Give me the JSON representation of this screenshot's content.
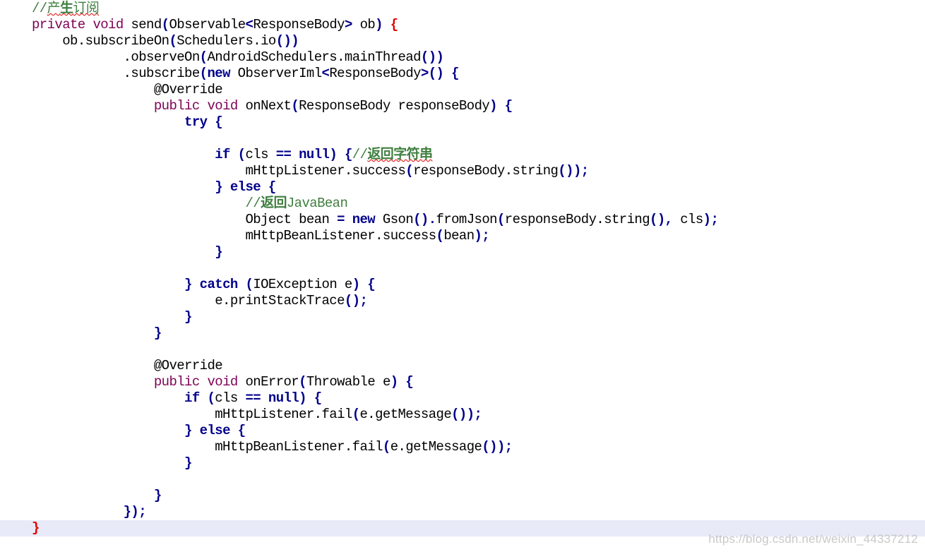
{
  "editor": {
    "current_line_index": 32,
    "lines": [
      {
        "indent": "",
        "tokens": [
          [
            "//",
            "cmt"
          ],
          [
            "产",
            "cmt-sq"
          ],
          [
            "生",
            "cmt-b-sq"
          ],
          [
            "订阅",
            "cmt-sq"
          ]
        ]
      },
      {
        "indent": "",
        "tokens": [
          [
            "private",
            "mod"
          ],
          [
            " ",
            "bk"
          ],
          [
            "void",
            "mod"
          ],
          [
            " send",
            "bk"
          ],
          [
            "(",
            "bl"
          ],
          [
            "Observable",
            "bk"
          ],
          [
            "<",
            "bl"
          ],
          [
            "ResponseBody",
            "bk"
          ],
          [
            ">",
            "bl"
          ],
          [
            " ob",
            "bk"
          ],
          [
            ")",
            "bl"
          ],
          [
            " ",
            "bk"
          ],
          [
            "{",
            "red"
          ]
        ]
      },
      {
        "indent": "    ",
        "tokens": [
          [
            "ob.subscribeOn",
            "bk"
          ],
          [
            "(",
            "bl"
          ],
          [
            "Schedulers.io",
            "bk"
          ],
          [
            "())",
            "bl"
          ]
        ]
      },
      {
        "indent": "            ",
        "tokens": [
          [
            ".observeOn",
            "bk"
          ],
          [
            "(",
            "bl"
          ],
          [
            "AndroidSchedulers.mainThread",
            "bk"
          ],
          [
            "())",
            "bl"
          ]
        ]
      },
      {
        "indent": "            ",
        "tokens": [
          [
            ".subscribe",
            "bk"
          ],
          [
            "(",
            "bl"
          ],
          [
            "new",
            "kwb"
          ],
          [
            " ObserverIml",
            "bk"
          ],
          [
            "<",
            "bl"
          ],
          [
            "ResponseBody",
            "bk"
          ],
          [
            ">()",
            "bl"
          ],
          [
            " ",
            "bk"
          ],
          [
            "{",
            "bl"
          ]
        ]
      },
      {
        "indent": "                ",
        "tokens": [
          [
            "@Override",
            "bk"
          ]
        ]
      },
      {
        "indent": "                ",
        "tokens": [
          [
            "public",
            "mod"
          ],
          [
            " ",
            "bk"
          ],
          [
            "void",
            "mod"
          ],
          [
            " onNext",
            "bk"
          ],
          [
            "(",
            "bl"
          ],
          [
            "ResponseBody responseBody",
            "bk"
          ],
          [
            ")",
            "bl"
          ],
          [
            " ",
            "bk"
          ],
          [
            "{",
            "bl"
          ]
        ]
      },
      {
        "indent": "                    ",
        "tokens": [
          [
            "try",
            "kwb"
          ],
          [
            " ",
            "bk"
          ],
          [
            "{",
            "bl"
          ]
        ]
      },
      {
        "indent": "",
        "tokens": []
      },
      {
        "indent": "                        ",
        "tokens": [
          [
            "if",
            "kwb"
          ],
          [
            " ",
            "bk"
          ],
          [
            "(",
            "bl"
          ],
          [
            "cls ",
            "bk"
          ],
          [
            "==",
            "bl"
          ],
          [
            " ",
            "bk"
          ],
          [
            "null",
            "kwb"
          ],
          [
            ")",
            "bl"
          ],
          [
            " ",
            "bk"
          ],
          [
            "{",
            "bl"
          ],
          [
            "//",
            "cmt"
          ],
          [
            "返回字符串",
            "cmt-b-sq"
          ]
        ]
      },
      {
        "indent": "                            ",
        "tokens": [
          [
            "mHttpListener.success",
            "bk"
          ],
          [
            "(",
            "bl"
          ],
          [
            "responseBody.string",
            "bk"
          ],
          [
            "());",
            "bl"
          ]
        ]
      },
      {
        "indent": "                        ",
        "tokens": [
          [
            "}",
            "bl"
          ],
          [
            " ",
            "bk"
          ],
          [
            "else",
            "kwb"
          ],
          [
            " ",
            "bk"
          ],
          [
            "{",
            "bl"
          ]
        ]
      },
      {
        "indent": "                            ",
        "tokens": [
          [
            "//",
            "cmt"
          ],
          [
            "返回",
            "cmt-b"
          ],
          [
            "JavaBean",
            "cmt"
          ]
        ]
      },
      {
        "indent": "                            ",
        "tokens": [
          [
            "Object bean ",
            "bk"
          ],
          [
            "=",
            "bl"
          ],
          [
            " ",
            "bk"
          ],
          [
            "new",
            "kwb"
          ],
          [
            " Gson",
            "bk"
          ],
          [
            "().",
            "bl"
          ],
          [
            "fromJson",
            "bk"
          ],
          [
            "(",
            "bl"
          ],
          [
            "responseBody.string",
            "bk"
          ],
          [
            "(),",
            "bl"
          ],
          [
            " cls",
            "bk"
          ],
          [
            ");",
            "bl"
          ]
        ]
      },
      {
        "indent": "                            ",
        "tokens": [
          [
            "mHttpBeanListener.success",
            "bk"
          ],
          [
            "(",
            "bl"
          ],
          [
            "bean",
            "bk"
          ],
          [
            ");",
            "bl"
          ]
        ]
      },
      {
        "indent": "                        ",
        "tokens": [
          [
            "}",
            "bl"
          ]
        ]
      },
      {
        "indent": "",
        "tokens": []
      },
      {
        "indent": "                    ",
        "tokens": [
          [
            "}",
            "bl"
          ],
          [
            " ",
            "bk"
          ],
          [
            "catch",
            "kwb"
          ],
          [
            " ",
            "bk"
          ],
          [
            "(",
            "bl"
          ],
          [
            "IOException e",
            "bk"
          ],
          [
            ")",
            "bl"
          ],
          [
            " ",
            "bk"
          ],
          [
            "{",
            "bl"
          ]
        ]
      },
      {
        "indent": "                        ",
        "tokens": [
          [
            "e.printStackTrace",
            "bk"
          ],
          [
            "();",
            "bl"
          ]
        ]
      },
      {
        "indent": "                    ",
        "tokens": [
          [
            "}",
            "bl"
          ]
        ]
      },
      {
        "indent": "                ",
        "tokens": [
          [
            "}",
            "bl"
          ]
        ]
      },
      {
        "indent": "",
        "tokens": []
      },
      {
        "indent": "                ",
        "tokens": [
          [
            "@Override",
            "bk"
          ]
        ]
      },
      {
        "indent": "                ",
        "tokens": [
          [
            "public",
            "mod"
          ],
          [
            " ",
            "bk"
          ],
          [
            "void",
            "mod"
          ],
          [
            " onError",
            "bk"
          ],
          [
            "(",
            "bl"
          ],
          [
            "Throwable e",
            "bk"
          ],
          [
            ")",
            "bl"
          ],
          [
            " ",
            "bk"
          ],
          [
            "{",
            "bl"
          ]
        ]
      },
      {
        "indent": "                    ",
        "tokens": [
          [
            "if",
            "kwb"
          ],
          [
            " ",
            "bk"
          ],
          [
            "(",
            "bl"
          ],
          [
            "cls ",
            "bk"
          ],
          [
            "==",
            "bl"
          ],
          [
            " ",
            "bk"
          ],
          [
            "null",
            "kwb"
          ],
          [
            ")",
            "bl"
          ],
          [
            " ",
            "bk"
          ],
          [
            "{",
            "bl"
          ]
        ]
      },
      {
        "indent": "                        ",
        "tokens": [
          [
            "mHttpListener.fail",
            "bk"
          ],
          [
            "(",
            "bl"
          ],
          [
            "e.getMessage",
            "bk"
          ],
          [
            "());",
            "bl"
          ]
        ]
      },
      {
        "indent": "                    ",
        "tokens": [
          [
            "}",
            "bl"
          ],
          [
            " ",
            "bk"
          ],
          [
            "else",
            "kwb"
          ],
          [
            " ",
            "bk"
          ],
          [
            "{",
            "bl"
          ]
        ]
      },
      {
        "indent": "                        ",
        "tokens": [
          [
            "mHttpBeanListener.fail",
            "bk"
          ],
          [
            "(",
            "bl"
          ],
          [
            "e.getMessage",
            "bk"
          ],
          [
            "());",
            "bl"
          ]
        ]
      },
      {
        "indent": "                    ",
        "tokens": [
          [
            "}",
            "bl"
          ]
        ]
      },
      {
        "indent": "",
        "tokens": []
      },
      {
        "indent": "                ",
        "tokens": [
          [
            "}",
            "bl"
          ]
        ]
      },
      {
        "indent": "            ",
        "tokens": [
          [
            "});",
            "bl"
          ]
        ]
      },
      {
        "indent": "",
        "tokens": [
          [
            "}",
            "red"
          ]
        ]
      }
    ]
  },
  "watermark": "https://blog.csdn.net/weixin_44337212",
  "colors": {
    "comment": "#3f7f3f",
    "keyword_bold": "#00008b",
    "modifier": "#7f0055",
    "brace_blue": "#00008b",
    "brace_red": "#e00000",
    "current_line_bg": "#e8eaf8"
  }
}
